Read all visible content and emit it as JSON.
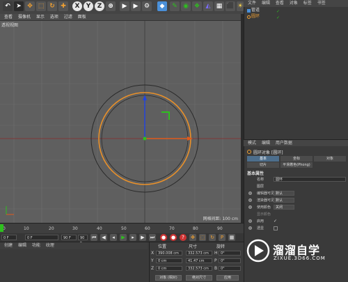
{
  "toolbar": {
    "axis_x": "X",
    "axis_y": "Y",
    "axis_z": "Z"
  },
  "viewport_menu": [
    "查看",
    "摄像机",
    "显示",
    "选项",
    "过滤",
    "面板"
  ],
  "viewport": {
    "label": "透视视图",
    "grid_info": "网格间距: 100 cm",
    "colors": {
      "orange_ring": "#e8902a",
      "dark_ring": "#2a2a2a",
      "x_axis": "#e05a1c",
      "y_axis": "#2244dd",
      "z_axis": "#2ec01e"
    }
  },
  "timeline": {
    "ticks": [
      "0",
      "10",
      "20",
      "30",
      "40",
      "50",
      "60",
      "70",
      "80",
      "90"
    ],
    "current_frame": "0 F",
    "start": "0 F",
    "end": "90 F",
    "end2": "90 F"
  },
  "material_menu": [
    "创建",
    "编辑",
    "功能",
    "纹理"
  ],
  "coords": {
    "headers": [
      "位置",
      "尺寸",
      "旋转"
    ],
    "rows": [
      {
        "axis": "X",
        "pos": "390.008 cm",
        "size": "332.573 cm",
        "rot_axis": "H",
        "rot": "0°"
      },
      {
        "axis": "Y",
        "pos": "0 cm",
        "size": "41.47 cm",
        "rot_axis": "P",
        "rot": "0°"
      },
      {
        "axis": "Z",
        "pos": "0 cm",
        "size": "332.573 cm",
        "rot_axis": "B",
        "rot": "0°"
      }
    ],
    "mode": "对象 (相对)",
    "size_mode": "绝对尺寸",
    "apply": "应用"
  },
  "right_menu": [
    "文件",
    "编辑",
    "查看",
    "对象",
    "标签",
    "书签"
  ],
  "objects": [
    {
      "name": "管道",
      "selected": false
    },
    {
      "name": "圆环",
      "selected": true
    }
  ],
  "attr_menu": [
    "模式",
    "编辑",
    "用户数据"
  ],
  "attr": {
    "object_title": "圆环对象 [圆环]",
    "tabs": [
      "基本",
      "坐标",
      "对象",
      "平滑着色(Phong)",
      "切片"
    ],
    "section": "基本属性",
    "props": [
      {
        "label": "名称",
        "value": "圆环"
      },
      {
        "label": "图层",
        "value": ""
      },
      {
        "label": "编辑器可见",
        "value": "默认"
      },
      {
        "label": "渲染器可见",
        "value": "默认"
      },
      {
        "label": "使用颜色",
        "value": "关闭"
      },
      {
        "label": "显示颜色",
        "value": ""
      },
      {
        "label": "启用",
        "value": "✓"
      },
      {
        "label": "透显",
        "value": ""
      }
    ]
  },
  "watermark": {
    "title": "溜溜自学",
    "url": "ZIXUE.3D66.COM"
  }
}
